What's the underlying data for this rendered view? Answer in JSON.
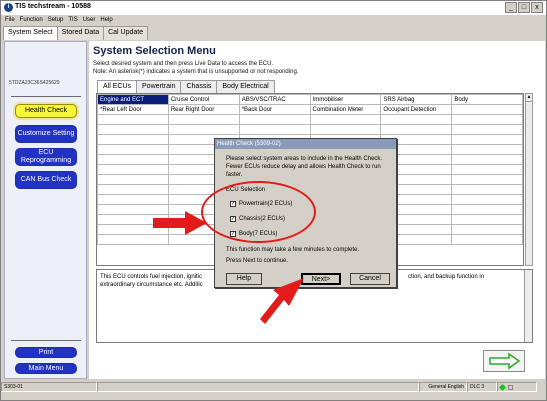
{
  "window": {
    "title": "TIS techstream - 10588",
    "app_icon_letter": "i",
    "minimize": "_",
    "maximize": "□",
    "close": "x"
  },
  "menu": [
    "File",
    "Function",
    "Setup",
    "TIS",
    "User",
    "Help"
  ],
  "top_tabs": [
    {
      "label": "System Select",
      "active": true
    },
    {
      "label": "Stored Data",
      "active": false
    },
    {
      "label": "Cal Update",
      "active": false
    }
  ],
  "sidebar": {
    "code": "5TDZA23C36S425629",
    "buttons": {
      "health_check": "Health Check",
      "customize": "Customize Setting",
      "ecu_reprogramming": "ECU Reprogramming",
      "can_bus_check": "CAN Bus Check",
      "print": "Print",
      "main_menu": "Main Menu"
    }
  },
  "main": {
    "title": "System Selection Menu",
    "desc_line1": "Select desired system and then press Live Data to access the ECU.",
    "desc_line2": "Note: An asterisk(*) indicates a system that is unsupported or not responding.",
    "ecu_tabs": [
      {
        "label": "All ECUs",
        "active": true
      },
      {
        "label": "Powertrain",
        "active": false
      },
      {
        "label": "Chassis",
        "active": false
      },
      {
        "label": "Body Electrical",
        "active": false
      }
    ],
    "grid_rows": [
      [
        "Engine and ECT",
        "Cruise Control",
        "ABS/VSC/TRAC",
        "Immobiliser",
        "SRS Airbag",
        "Body"
      ],
      [
        "*Rear Left Door",
        "Rear Right Door",
        "*Back Door",
        "Combination Meter",
        "Occupant Detection",
        ""
      ]
    ],
    "info_left": "This ECU controls fuel injection, ignitic extraordinary circumstance etc. Additic",
    "info_right": "ction, and backup function in"
  },
  "dialog": {
    "title": "Health Check (5309-02)",
    "message": "Please select system areas to include in the Health Check. Fewer ECUs reduce delay and allows Health Check to run faster.",
    "selection_label": "ECU Selection",
    "checkboxes": [
      {
        "label": "Powertrain(2 ECUs)",
        "checked": true
      },
      {
        "label": "Chassis(2 ECUs)",
        "checked": true
      },
      {
        "label": "Body(7 ECUs)",
        "checked": true
      }
    ],
    "note1": "This function may take a few minutes to complete.",
    "note2": "Press Next to continue.",
    "help": "Help",
    "next": "Next>",
    "cancel": "Cancel"
  },
  "statusbar": {
    "left": "S303-01",
    "language": "General English",
    "dlc": "DLC 3"
  },
  "colors": {
    "highlight_yellow": "#f6f63a",
    "nav_blue": "#2233c4",
    "annotation_red": "#e31b1b",
    "status_green": "#22c022"
  }
}
